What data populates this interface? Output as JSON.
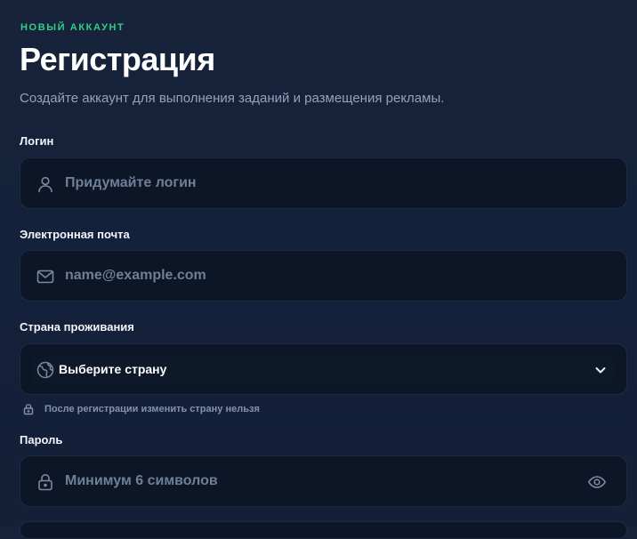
{
  "header": {
    "eyebrow": "НОВЫЙ АККАУНТ",
    "title": "Регистрация",
    "subtitle": "Создайте аккаунт для выполнения заданий и размещения рекламы."
  },
  "form": {
    "login": {
      "label": "Логин",
      "placeholder": "Придумайте логин",
      "value": "",
      "icon": "user-icon"
    },
    "email": {
      "label": "Электронная почта",
      "placeholder": "name@example.com",
      "value": "",
      "icon": "mail-icon"
    },
    "country": {
      "label": "Страна проживания",
      "selected": "Выберите страну",
      "icon": "globe-icon",
      "dropdown_icon": "chevron-down-icon",
      "hint": "После регистрации изменить страну нельзя",
      "hint_icon": "lock-icon"
    },
    "password": {
      "label": "Пароль",
      "placeholder": "Минимум 6 символов",
      "value": "",
      "icon": "lock-icon",
      "toggle_icon": "eye-icon"
    }
  },
  "colors": {
    "background": "#16233a",
    "field_background": "#0c1627",
    "accent": "#2fcf86",
    "text": "#ffffff",
    "muted_text": "#93a3ba",
    "placeholder": "#6f7f96"
  }
}
